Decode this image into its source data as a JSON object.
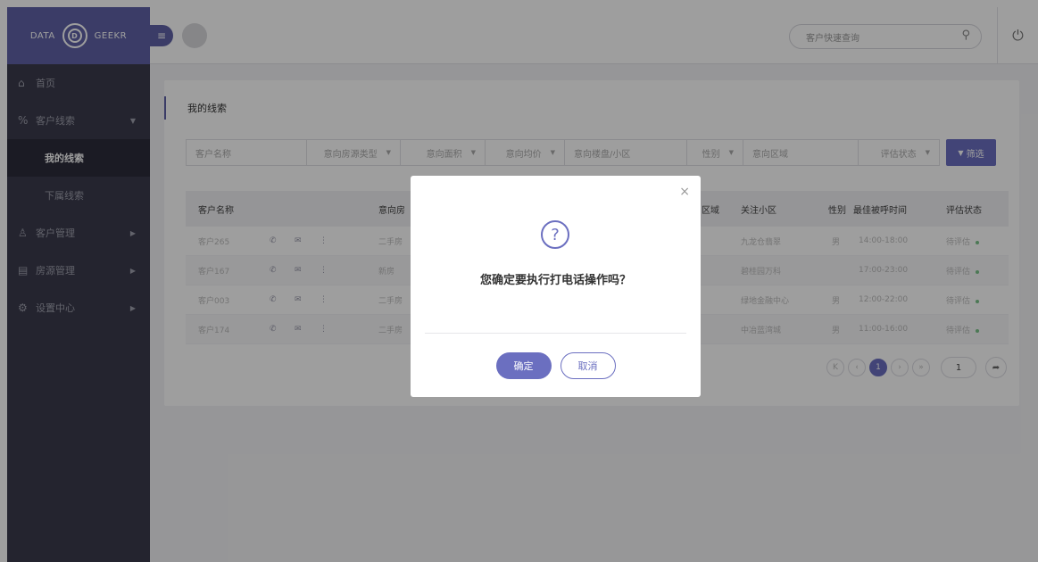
{
  "brand": {
    "left": "DATA",
    "logo_letter": "D",
    "right": "GEEKR"
  },
  "sidebar": {
    "items": [
      {
        "icon": "⌂",
        "label": "首页"
      },
      {
        "icon": "%",
        "label": "客户线索",
        "arrow": "▼"
      },
      {
        "label": "我的线索"
      },
      {
        "label": "下属线索"
      },
      {
        "icon": "♙",
        "label": "客户管理",
        "arrow": "▶"
      },
      {
        "icon": "▤",
        "label": "房源管理",
        "arrow": "▶"
      },
      {
        "icon": "⚙",
        "label": "设置中心",
        "arrow": "▶"
      }
    ]
  },
  "topbar": {
    "menu_icon": "≡",
    "search_placeholder": "客户快速查询",
    "search_icon": "⚲",
    "power_icon": "⏻"
  },
  "page": {
    "title": "我的线索"
  },
  "filters": {
    "customer_name": "客户名称",
    "house_type": "意向房源类型",
    "area": "意向面积",
    "avg_price": "意向均价",
    "community": "意向楼盘/小区",
    "gender": "性别",
    "district": "意向区域",
    "eval_status": "评估状态",
    "filter_button": "筛选",
    "filter_icon": "▼",
    "caret": "▼"
  },
  "table": {
    "headers": {
      "name": "客户名称",
      "house": "意向房",
      "district": "区域",
      "community": "关注小区",
      "gender": "性别",
      "call_time": "最佳被呼时间",
      "status": "评估状态"
    },
    "rows": [
      {
        "name": "客户265",
        "house": "二手房",
        "community": "九龙仓翡翠",
        "gender": "男",
        "time": "14:00-18:00",
        "status": "待评估"
      },
      {
        "name": "客户167",
        "house": "新房",
        "community": "碧桂园万科",
        "gender": "",
        "time": "17:00-23:00",
        "status": "待评估"
      },
      {
        "name": "客户003",
        "house": "二手房",
        "community": "绿地金融中心",
        "gender": "男",
        "time": "12:00-22:00",
        "status": "待评估"
      },
      {
        "name": "客户174",
        "house": "二手房",
        "community": "中冶蓝湾城",
        "gender": "男",
        "time": "11:00-16:00",
        "status": "待评估"
      }
    ],
    "row_icons": {
      "phone": "✆",
      "mail": "✉",
      "more": "⋮"
    }
  },
  "pager": {
    "first": "K",
    "prev": "‹",
    "current": "1",
    "next": "›",
    "last": "»",
    "page_input": "1",
    "go": "➦"
  },
  "modal": {
    "close": "×",
    "icon": "?",
    "message": "您确定要执行打电话操作吗？",
    "ok_label": "确定",
    "cancel_label": "取消"
  }
}
